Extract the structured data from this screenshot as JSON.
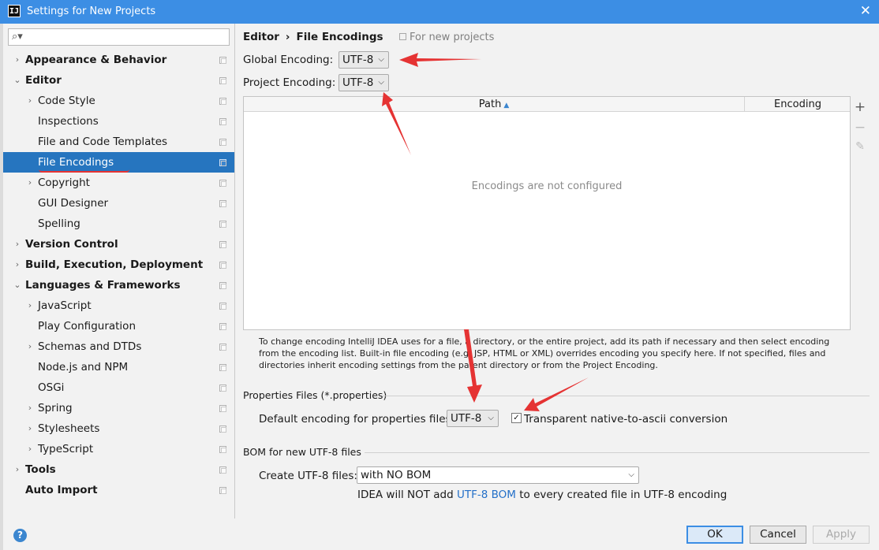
{
  "window": {
    "title": "Settings for New Projects",
    "app_icon": "IJ"
  },
  "search": {
    "placeholder": "",
    "value": ""
  },
  "tree": [
    {
      "label": "Appearance & Behavior",
      "level": 0,
      "bold": true,
      "arrow": "›",
      "selected": false
    },
    {
      "label": "Editor",
      "level": 0,
      "bold": true,
      "arrow": "⌄",
      "selected": false
    },
    {
      "label": "Code Style",
      "level": 1,
      "bold": false,
      "arrow": "›",
      "selected": false
    },
    {
      "label": "Inspections",
      "level": 1,
      "bold": false,
      "arrow": "",
      "selected": false
    },
    {
      "label": "File and Code Templates",
      "level": 1,
      "bold": false,
      "arrow": "",
      "selected": false
    },
    {
      "label": "File Encodings",
      "level": 1,
      "bold": false,
      "arrow": "",
      "selected": true
    },
    {
      "label": "Copyright",
      "level": 1,
      "bold": false,
      "arrow": "›",
      "selected": false
    },
    {
      "label": "GUI Designer",
      "level": 1,
      "bold": false,
      "arrow": "",
      "selected": false
    },
    {
      "label": "Spelling",
      "level": 1,
      "bold": false,
      "arrow": "",
      "selected": false
    },
    {
      "label": "Version Control",
      "level": 0,
      "bold": true,
      "arrow": "›",
      "selected": false
    },
    {
      "label": "Build, Execution, Deployment",
      "level": 0,
      "bold": true,
      "arrow": "›",
      "selected": false
    },
    {
      "label": "Languages & Frameworks",
      "level": 0,
      "bold": true,
      "arrow": "⌄",
      "selected": false
    },
    {
      "label": "JavaScript",
      "level": 1,
      "bold": false,
      "arrow": "›",
      "selected": false
    },
    {
      "label": "Play Configuration",
      "level": 1,
      "bold": false,
      "arrow": "",
      "selected": false
    },
    {
      "label": "Schemas and DTDs",
      "level": 1,
      "bold": false,
      "arrow": "›",
      "selected": false
    },
    {
      "label": "Node.js and NPM",
      "level": 1,
      "bold": false,
      "arrow": "",
      "selected": false
    },
    {
      "label": "OSGi",
      "level": 1,
      "bold": false,
      "arrow": "",
      "selected": false
    },
    {
      "label": "Spring",
      "level": 1,
      "bold": false,
      "arrow": "›",
      "selected": false
    },
    {
      "label": "Stylesheets",
      "level": 1,
      "bold": false,
      "arrow": "›",
      "selected": false
    },
    {
      "label": "TypeScript",
      "level": 1,
      "bold": false,
      "arrow": "›",
      "selected": false
    },
    {
      "label": "Tools",
      "level": 0,
      "bold": true,
      "arrow": "›",
      "selected": false
    },
    {
      "label": "Auto Import",
      "level": 0,
      "bold": true,
      "arrow": "",
      "selected": false
    }
  ],
  "breadcrumb": {
    "parent": "Editor",
    "separator": "›",
    "current": "File Encodings"
  },
  "scope_note": "For new projects",
  "global_encoding": {
    "label": "Global Encoding:",
    "value": "UTF-8"
  },
  "project_encoding": {
    "label": "Project Encoding:",
    "value": "UTF-8"
  },
  "table": {
    "columns": [
      "Path",
      "Encoding"
    ],
    "sort_indicator": "▲",
    "empty_text": "Encodings are not configured"
  },
  "toolbar": {
    "add": "+",
    "remove": "−",
    "edit": "✎"
  },
  "description": "To change encoding IntelliJ IDEA uses for a file, a directory, or the entire project, add its path if necessary and then select encoding from the encoding list. Built-in file encoding (e.g. JSP, HTML or XML) overrides encoding you specify here. If not specified, files and directories inherit encoding settings from the parent directory or from the Project Encoding.",
  "properties": {
    "section_title": "Properties Files (*.properties)",
    "default_label": "Default encoding for properties files:",
    "default_value": "UTF-8",
    "checkbox_label": "Transparent native-to-ascii conversion",
    "checkbox_checked": true,
    "check_mark": "✓"
  },
  "bom": {
    "section_title": "BOM for new UTF-8 files",
    "create_label": "Create UTF-8 files:",
    "create_value": "with NO BOM",
    "note_before": "IDEA will NOT add ",
    "note_link": "UTF-8 BOM",
    "note_after": " to every created file in UTF-8 encoding"
  },
  "buttons": {
    "ok": "OK",
    "cancel": "Cancel",
    "apply": "Apply",
    "help": "?"
  },
  "colors": {
    "titlebar": "#3c8ee4",
    "selection": "#2675bf",
    "annotation": "#e53333"
  }
}
